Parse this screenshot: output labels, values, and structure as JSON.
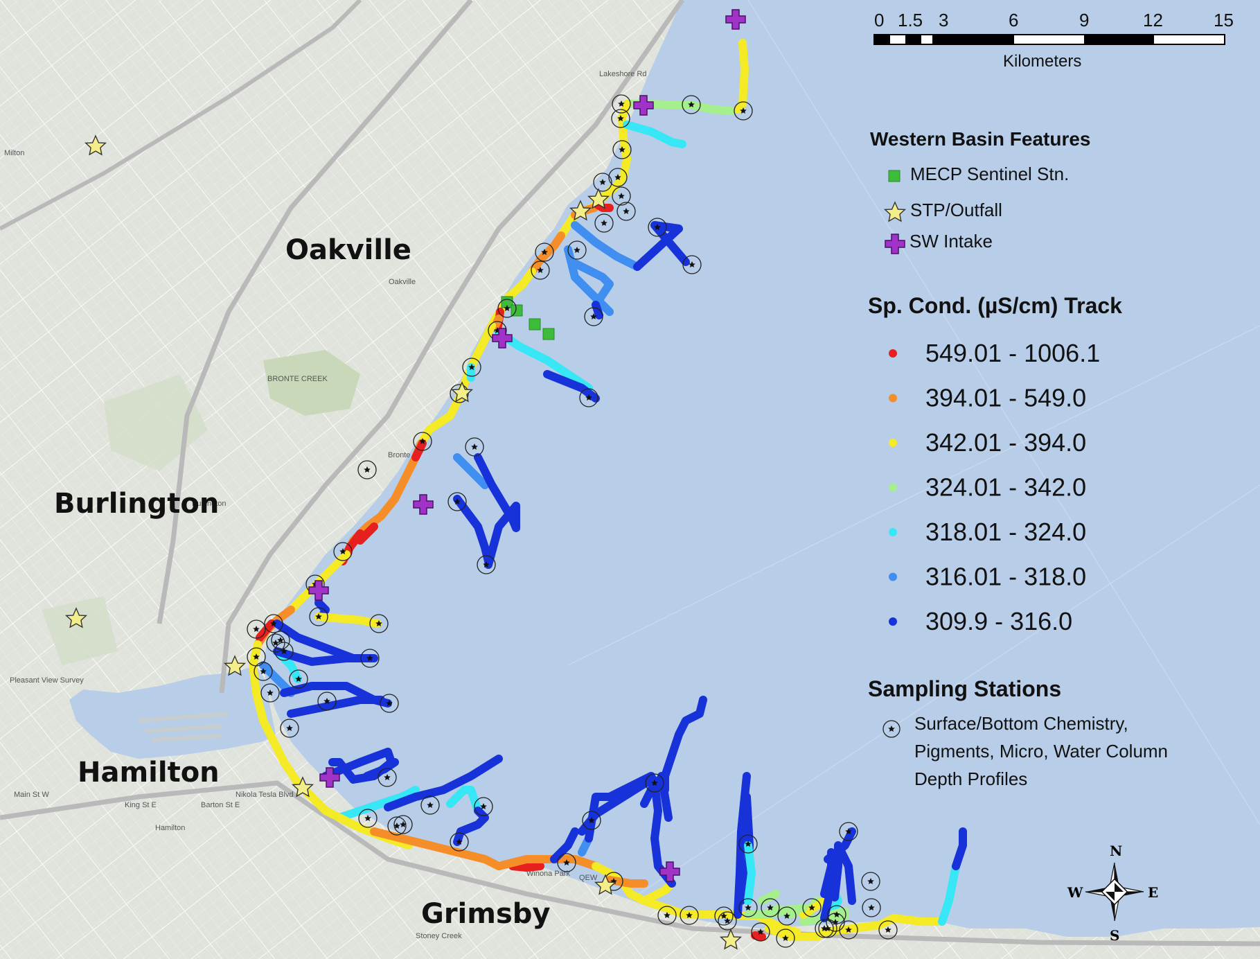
{
  "colors": {
    "water": "#b7cde8",
    "land": "#dfe3dc",
    "urban": "#d0d3cf",
    "green": "#c9d8b8",
    "road": "#ffffff",
    "highway": "#b9b9b9"
  },
  "cities": [
    {
      "id": "oakville",
      "label": "Oakville"
    },
    {
      "id": "burlington",
      "label": "Burlington"
    },
    {
      "id": "hamilton",
      "label": "Hamilton"
    },
    {
      "id": "grimsby",
      "label": "Grimsby"
    }
  ],
  "basemap_labels": [
    "Milton",
    "Oakville",
    "Bronte",
    "BRONTE CREEK",
    "Burlington",
    "Hamilton",
    "Pleasant View Survey",
    "Winona Park",
    "Stoney Creek",
    "Main St W",
    "King St E",
    "Barton St E",
    "Nikola Tesla Blvd",
    "QEW",
    "Lakeshore Rd"
  ],
  "scale_bar": {
    "ticks": [
      "0",
      "1.5",
      "3",
      "6",
      "9",
      "12",
      "15"
    ],
    "unit": "Kilometers"
  },
  "legend": {
    "features_title": "Western Basin Features",
    "features": [
      {
        "icon": "green-square-icon",
        "label": "MECP Sentinel Stn.",
        "color": "#3dbb3a"
      },
      {
        "icon": "yellow-star-icon",
        "label": "STP/Outfall",
        "color": "#f4ee8a"
      },
      {
        "icon": "purple-cross-icon",
        "label": "SW Intake",
        "color": "#a132c8"
      }
    ],
    "track_title": "Sp. Cond. (µS/cm) Track",
    "track_classes": [
      {
        "range": "549.01 - 1006.1",
        "color": "#e5201e"
      },
      {
        "range": "394.01 - 549.0",
        "color": "#f58d28"
      },
      {
        "range": "342.01 - 394.0",
        "color": "#f4ea25"
      },
      {
        "range": "324.01 - 342.0",
        "color": "#a6ef8d"
      },
      {
        "range": "318.01 - 324.0",
        "color": "#37e7f5"
      },
      {
        "range": "316.01 - 318.0",
        "color": "#3f8ef0"
      },
      {
        "range": "309.9 - 316.0",
        "color": "#1632d8"
      }
    ],
    "stations_title": "Sampling Stations",
    "station_icon": "circled-star-icon",
    "stations_label_lines": [
      "Surface/Bottom Chemistry,",
      "Pigments, Micro, Water Column",
      "Depth Profiles"
    ]
  },
  "north_arrow": {
    "n": "N",
    "s": "S",
    "e": "E",
    "w": "W"
  }
}
